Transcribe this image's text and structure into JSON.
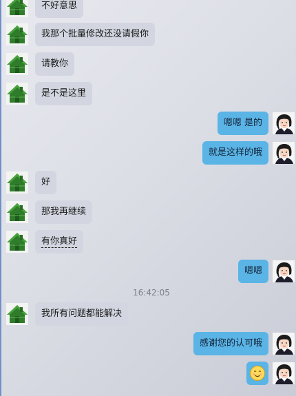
{
  "conversation": {
    "messages": [
      {
        "side": "in",
        "text": "不好意思"
      },
      {
        "side": "in",
        "text": "我那个批量修改还没请假你"
      },
      {
        "side": "in",
        "text": "请教你"
      },
      {
        "side": "in",
        "text": "是不是这里"
      },
      {
        "side": "out",
        "text": "嗯嗯 是的"
      },
      {
        "side": "out",
        "text": "就是这样的哦"
      },
      {
        "side": "in",
        "text": "好"
      },
      {
        "side": "in",
        "text": "那我再继续"
      },
      {
        "side": "in",
        "text": "有你真好"
      },
      {
        "side": "out",
        "text": "嗯嗯"
      },
      {
        "side": "in",
        "text": "我所有问题都能解决"
      },
      {
        "side": "out",
        "text": "感谢您的认可哦"
      },
      {
        "side": "out",
        "emoji": "smile-emoji-icon"
      }
    ],
    "timestamp": "16:42:05"
  },
  "colors": {
    "incoming_bubble": "#d3d6e0",
    "outgoing_bubble": "#5ab4e5",
    "window_edge": "#6f8fc7"
  },
  "icons": {
    "incoming_avatar": "green-house-avatar-icon",
    "outgoing_avatar": "woman-agent-avatar-icon"
  }
}
